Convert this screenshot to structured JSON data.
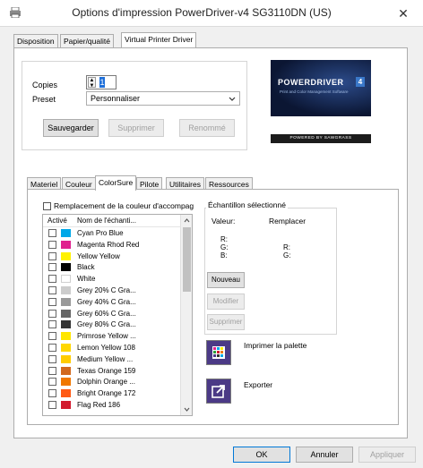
{
  "window": {
    "title": "Options d'impression PowerDriver-v4 SG3110DN (US)",
    "close": "✕"
  },
  "outer_tabs": [
    "Disposition",
    "Papier/qualité",
    "Virtual Printer Driver"
  ],
  "copies": {
    "label": "Copies",
    "value": "1"
  },
  "preset": {
    "label": "Preset",
    "value": "Personnaliser"
  },
  "preset_buttons": {
    "save": "Sauvegarder",
    "delete": "Supprimer",
    "rename": "Renommé"
  },
  "logo": {
    "text": "POWERDRIVER",
    "badge": "4",
    "tagline": "Print and Color Management Software",
    "powered": "POWERED BY SAWGRASS"
  },
  "inner_tabs": [
    "Materiel",
    "Couleur",
    "ColorSure",
    "Pilote",
    "Utilitaires",
    "Ressources"
  ],
  "spot_replace": {
    "label": "Remplacement de la couleur d'accompag"
  },
  "list_header": {
    "col1": "Activé",
    "col2": "Nom de l'échanti..."
  },
  "swatches": [
    {
      "name": "Cyan Pro Blue",
      "color": "#00a8e8"
    },
    {
      "name": "Magenta Rhod Red",
      "color": "#e0208e"
    },
    {
      "name": "Yellow Yellow",
      "color": "#fff200"
    },
    {
      "name": "Black",
      "color": "#000000"
    },
    {
      "name": "White",
      "color": "#ffffff"
    },
    {
      "name": "Grey 20% C Gra...",
      "color": "#cccccc"
    },
    {
      "name": "Grey 40% C Gra...",
      "color": "#999999"
    },
    {
      "name": "Grey 60% C Gra...",
      "color": "#666666"
    },
    {
      "name": "Grey 80% C Gra...",
      "color": "#333333"
    },
    {
      "name": "Primrose Yellow ...",
      "color": "#ffe600"
    },
    {
      "name": "Lemon Yellow 108",
      "color": "#ffd700"
    },
    {
      "name": "Medium Yellow ...",
      "color": "#ffcc00"
    },
    {
      "name": "Texas Orange 159",
      "color": "#d2691e"
    },
    {
      "name": "Dolphin Orange ...",
      "color": "#f07800"
    },
    {
      "name": "Bright Orange 172",
      "color": "#ff5a14"
    },
    {
      "name": "Flag Red 186",
      "color": "#d2192d"
    }
  ],
  "sample": {
    "group": "Échantillon sélectionné",
    "value_label": "Valeur:",
    "replace_label": "Remplacer",
    "r": "R:",
    "g": "G:",
    "b": "B:",
    "new": "Nouveau",
    "modify": "Modifier",
    "delete": "Supprimer"
  },
  "actions": {
    "print_palette": "Imprimer la palette",
    "export": "Exporter"
  },
  "footer": {
    "ok": "OK",
    "cancel": "Annuler",
    "apply": "Appliquer"
  }
}
